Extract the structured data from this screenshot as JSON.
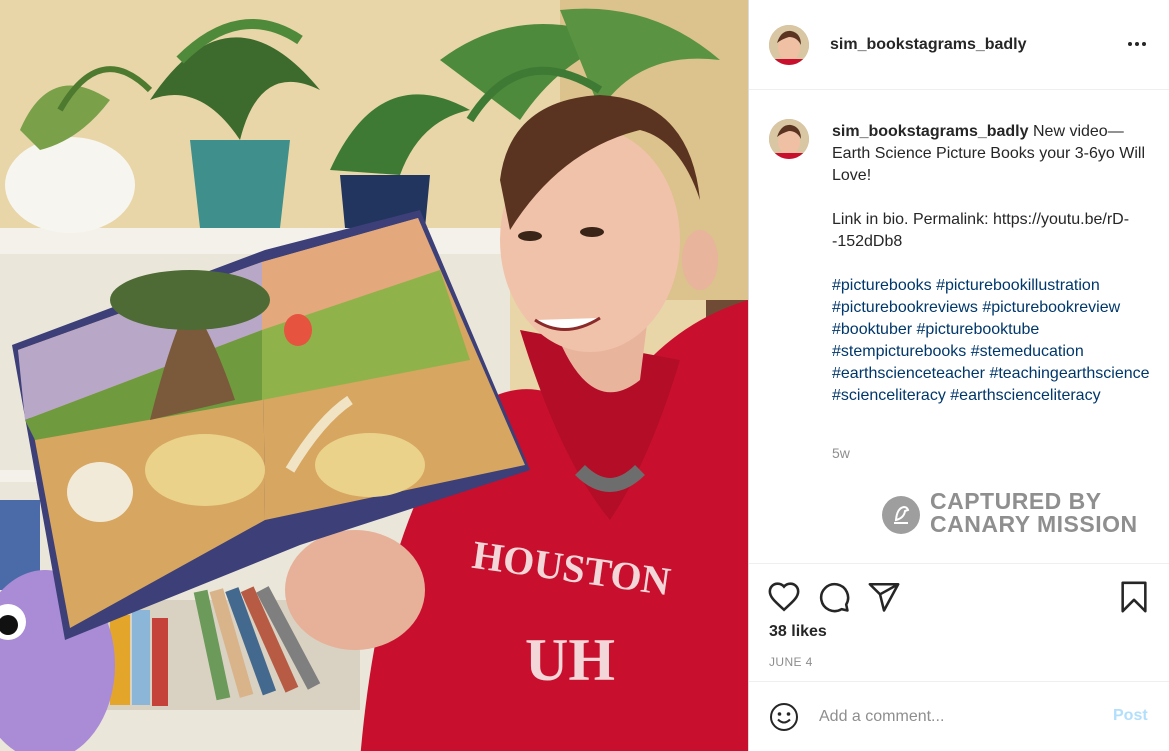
{
  "post": {
    "username": "sim_bookstagrams_badly",
    "photo_description": "photo",
    "hoodie_text": "HOUSTON",
    "hoodie_logo": "UH"
  },
  "caption": {
    "username": "sim_bookstagrams_badly",
    "line1": "New video—Earth Science Picture Books your 3-6yo Will Love!",
    "line2": "Link in bio. Permalink: https://youtu.be/rD--152dDb8",
    "hashtags": [
      "#picturebooks",
      "#picturebookillustration",
      "#picturebookreviews",
      "#picturebookreview",
      "#booktuber",
      "#picturebooktube",
      "#stempicturebooks",
      "#stemeducation",
      "#earthscienceteacher",
      "#teachingearthscience",
      "#scienceliteracy",
      "#earthscienceliteracy"
    ],
    "age": "5w"
  },
  "watermark": {
    "line1": "CAPTURED BY",
    "line2": "CANARY MISSION"
  },
  "actions": {
    "like_icon": "heart-icon",
    "comment_icon": "comment-icon",
    "share_icon": "paper-plane-icon",
    "save_icon": "bookmark-icon",
    "likes": "38 likes",
    "date": "JUNE 4"
  },
  "comment": {
    "emoji_icon": "smiley-icon",
    "placeholder": "Add a comment...",
    "post_label": "Post",
    "post_color": "#b2dffc"
  },
  "colors": {
    "hashtag": "#00376b",
    "text": "#262626",
    "muted": "#8e8e8e",
    "hoodie": "#c8102e"
  }
}
